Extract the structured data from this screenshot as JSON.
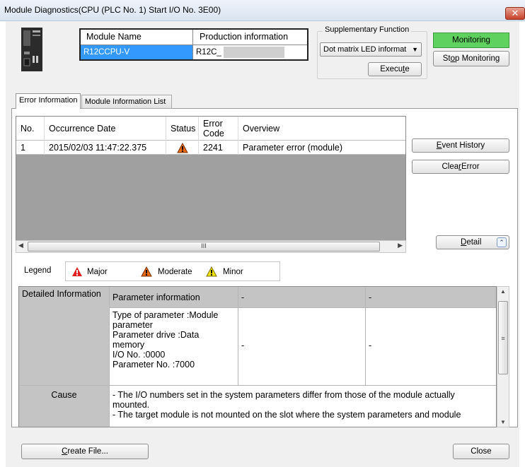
{
  "window": {
    "title": "Module Diagnostics(CPU (PLC No. 1) Start I/O No. 3E00)",
    "close_glyph": "✕"
  },
  "module": {
    "name_header": "Module Name",
    "production_header": "Production information",
    "name_value": "R12CCPU-V",
    "production_value": "R12C_"
  },
  "supplementary": {
    "label": "Supplementary Function",
    "selected": "Dot matrix LED informat",
    "execute_pre": "Execu",
    "execute_acc": "t",
    "execute_post": "e"
  },
  "monitoring": {
    "status": "Monitoring",
    "stop_pre": "St",
    "stop_acc": "o",
    "stop_post": "p Monitoring"
  },
  "tabs": [
    {
      "label": "Error Information",
      "active": true
    },
    {
      "label": "Module Information List",
      "active": false
    }
  ],
  "error_grid": {
    "headers": {
      "no": "No.",
      "date": "Occurrence Date",
      "status": "Status",
      "code": "Error\nCode",
      "overview": "Overview"
    },
    "rows": [
      {
        "no": "1",
        "date": "2015/02/03 11:47:22.375",
        "status": "moderate",
        "code": "2241",
        "overview": "Parameter error (module)"
      }
    ],
    "scroll_grip": "III"
  },
  "actions": {
    "event_history_acc": "E",
    "event_history_post": "vent History",
    "clear_error_pre": "Clea",
    "clear_error_acc": "r",
    "clear_error_post": " Error",
    "detail_acc": "D",
    "detail_post": "etail"
  },
  "legend": {
    "label": "Legend",
    "major": "Major",
    "moderate": "Moderate",
    "minor": "Minor",
    "colors": {
      "major": "#e02020",
      "moderate": "#e86a10",
      "minor": "#f2e200"
    }
  },
  "detail": {
    "label_info": "Detailed Information",
    "label_cause": "Cause",
    "header": "Parameter information",
    "header2": "-",
    "header3": "-",
    "info_lines": [
      "Type of parameter :Module",
      "parameter",
      "Parameter drive :Data",
      "memory",
      "I/O No. :0000",
      "Parameter No. :7000"
    ],
    "col2": "-",
    "col3": "-",
    "cause_lines": [
      "- The I/O numbers set in the system parameters differ from those of the module actually",
      "mounted.",
      "- The target module is not mounted on the slot where the system parameters and module"
    ],
    "vscroll_grip": "≡"
  },
  "footer": {
    "create_file_acc": "C",
    "create_file_post": "reate File...",
    "close": "Close"
  }
}
